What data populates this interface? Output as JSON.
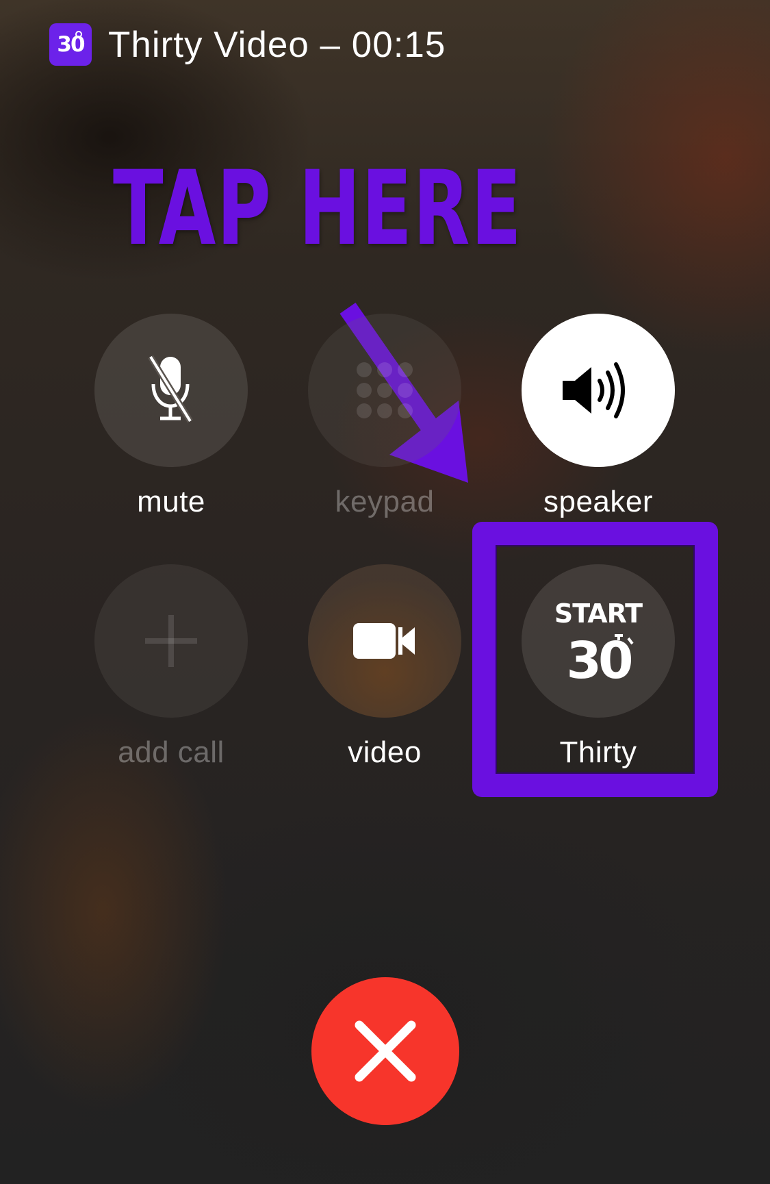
{
  "status": {
    "app_icon_text": "30",
    "title": "Thirty Video – 00:15"
  },
  "annotation": {
    "headline": "TAP HERE",
    "color": "#6a10e0"
  },
  "controls": {
    "mute": {
      "label": "mute",
      "icon": "mic-slash-icon"
    },
    "keypad": {
      "label": "keypad",
      "icon": "keypad-icon"
    },
    "speaker": {
      "label": "speaker",
      "icon": "speaker-icon"
    },
    "add_call": {
      "label": "add call",
      "icon": "plus-icon"
    },
    "video": {
      "label": "video",
      "icon": "video-camera-icon"
    },
    "thirty": {
      "label": "Thirty",
      "start_text": "START",
      "number": "30",
      "icon": "start-30-icon"
    }
  },
  "end_call": {
    "icon": "close-icon",
    "color": "#f7352b"
  }
}
